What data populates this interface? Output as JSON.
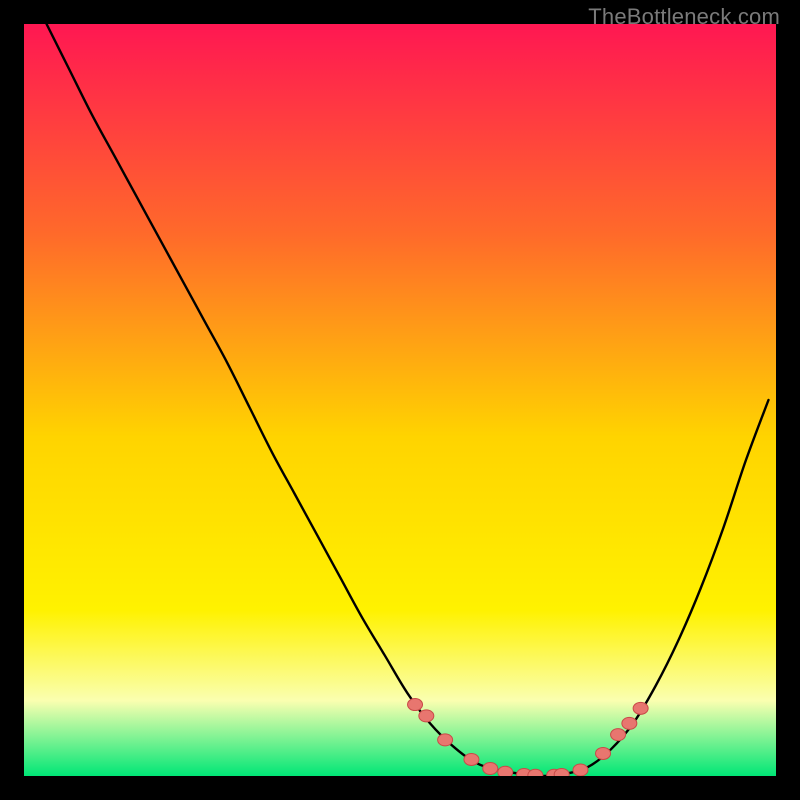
{
  "watermark": "TheBottleneck.com",
  "colors": {
    "gradient_top": "#ff1752",
    "gradient_mid1": "#ff6a2a",
    "gradient_mid2": "#ffd400",
    "gradient_mid3": "#fff200",
    "gradient_mid4": "#faffb0",
    "gradient_bottom": "#00e676",
    "curve": "#000000",
    "marker_fill": "#e8766f",
    "marker_stroke": "#c94a48"
  },
  "chart_data": {
    "type": "line",
    "title": "",
    "xlabel": "",
    "ylabel": "",
    "xlim": [
      0,
      100
    ],
    "ylim": [
      0,
      100
    ],
    "grid": false,
    "legend": false,
    "series": [
      {
        "name": "bottleneck-curve",
        "x": [
          3,
          6,
          9,
          12,
          15,
          18,
          21,
          24,
          27,
          30,
          33,
          36,
          39,
          42,
          45,
          48,
          51,
          54,
          57,
          60,
          63,
          66,
          69,
          72,
          75,
          78,
          81,
          84,
          87,
          90,
          93,
          96,
          99
        ],
        "y": [
          100,
          94,
          88,
          82.5,
          77,
          71.5,
          66,
          60.5,
          55,
          49,
          43,
          37.5,
          32,
          26.5,
          21,
          16,
          11,
          7,
          4,
          1.8,
          0.8,
          0.3,
          0,
          0.3,
          1.2,
          3.5,
          7,
          12,
          18,
          25,
          33,
          42,
          50
        ]
      }
    ],
    "markers": {
      "name": "highlight-points",
      "x": [
        52,
        53.5,
        56,
        59.5,
        62,
        64,
        66.5,
        68,
        70.5,
        71.5,
        74,
        77,
        79,
        80.5,
        82
      ],
      "y": [
        9.5,
        8,
        4.8,
        2.2,
        1,
        0.5,
        0.2,
        0.1,
        0.1,
        0.2,
        0.8,
        3,
        5.5,
        7,
        9
      ]
    }
  }
}
